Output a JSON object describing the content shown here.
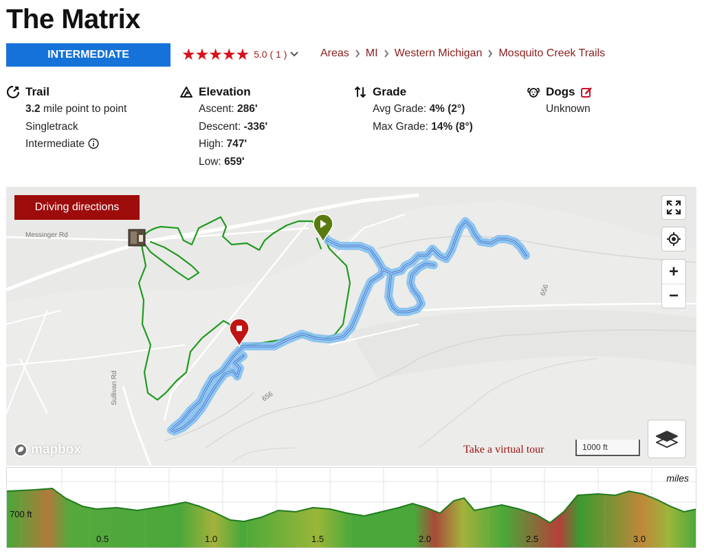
{
  "trail": {
    "title": "The Matrix",
    "difficulty": "INTERMEDIATE"
  },
  "rating": {
    "stars": "★★★★★",
    "text": "5.0 ( 1 )"
  },
  "breadcrumb": [
    "Areas",
    "MI",
    "Western Michigan",
    "Mosquito Creek Trails"
  ],
  "stats": {
    "trail": {
      "heading": "Trail",
      "distance_value": "3.2",
      "distance_suffix": " mile point to point",
      "type": "Singletrack",
      "difficulty": "Intermediate"
    },
    "elevation": {
      "heading": "Elevation",
      "ascent_label": "Ascent: ",
      "ascent": "286'",
      "descent_label": "Descent: ",
      "descent": "-336'",
      "high_label": "High: ",
      "high": "747'",
      "low_label": "Low: ",
      "low": "659'"
    },
    "grade": {
      "heading": "Grade",
      "avg_label": "Avg Grade: ",
      "avg": "4% (2°)",
      "max_label": "Max Grade: ",
      "max": "14% (8°)"
    },
    "dogs": {
      "heading": "Dogs",
      "value": "Unknown"
    }
  },
  "map": {
    "driving_directions": "Driving directions",
    "roads": [
      "Messinger Rd",
      "Sullivan Rd",
      "656",
      "656"
    ],
    "logo_text": "mapbox",
    "virtual_tour": "Take a virtual tour",
    "scale": "1000 ft",
    "zoom_in": "+",
    "zoom_out": "−"
  },
  "profile": {
    "units": "miles",
    "elevation_label": "700 ft",
    "ticks": [
      "0.5",
      "1.0",
      "1.5",
      "2.0",
      "2.5",
      "3.0"
    ]
  },
  "colors": {
    "accent_blue": "#1572d8",
    "brand_red": "#9d0b0b",
    "star_red": "#d8101a",
    "link_red": "#8c1c1c",
    "trail_green": "#1f9a1f",
    "route_blue": "#2f6fd0"
  }
}
